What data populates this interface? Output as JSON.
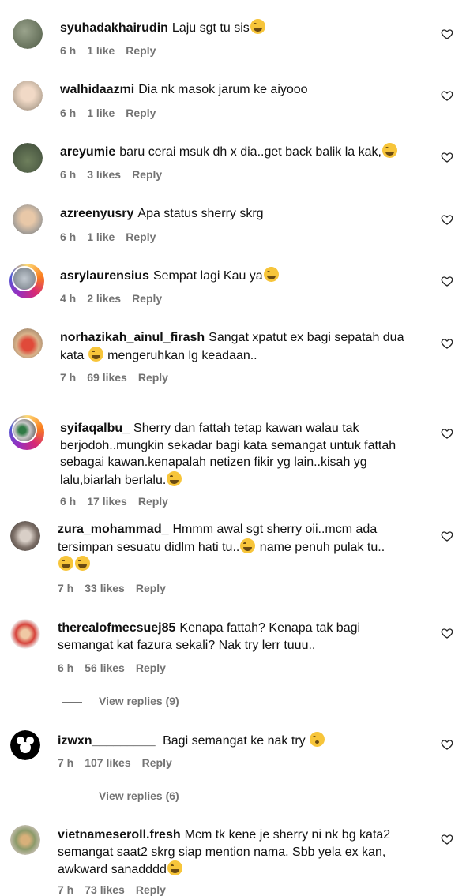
{
  "comments": [
    {
      "username": "syuhadakhairudin",
      "text": "Laju sgt tu sis",
      "emoji": "😂",
      "time": "6 h",
      "likes": "1 like",
      "reply": "Reply"
    },
    {
      "username": "walhidaazmi",
      "text": "Dia nk masok jarum ke aiyooo",
      "emoji": "",
      "time": "6 h",
      "likes": "1 like",
      "reply": "Reply"
    },
    {
      "username": "areyumie",
      "text": "baru cerai msuk dh x dia..get back balik la kak,",
      "emoji": "😂",
      "time": "6 h",
      "likes": "3 likes",
      "reply": "Reply"
    },
    {
      "username": "azreenyusry",
      "text": "Apa status sherry skrg",
      "emoji": "",
      "time": "6 h",
      "likes": "1 like",
      "reply": "Reply"
    },
    {
      "username": "asrylaurensius",
      "text": "Sempat lagi Kau ya",
      "emoji": "😂",
      "time": "4 h",
      "likes": "2 likes",
      "reply": "Reply"
    },
    {
      "username": "norhazikah_ainul_firash",
      "text_a": "Sangat xpatut ex bagi sepatah dua kata",
      "text_b": "mengeruhkan lg keadaan..",
      "time": "7 h",
      "likes": "69 likes",
      "reply": "Reply"
    },
    {
      "username": "syifaqalbu_",
      "text": "Sherry dan fattah tetap kawan walau tak berjodoh..mungkin sekadar bagi kata semangat untuk fattah sebagai kawan.kenapalah netizen fikir yg lain..kisah yg lalu,biarlah berlalu.",
      "emoji": "😂",
      "time": "6 h",
      "likes": "17 likes",
      "reply": "Reply"
    },
    {
      "username": "zura_mohammad_",
      "text_a": "Hmmm awal sgt sherry oii..mcm ada tersimpan sesuatu didlm hati tu..",
      "text_b": "name penuh pulak tu..",
      "time": "7 h",
      "likes": "33 likes",
      "reply": "Reply"
    },
    {
      "username": "therealofmecsuej85",
      "text": "Kenapa fattah? Kenapa tak bagi semangat kat fazura sekali? Nak try lerr tuuu..",
      "emoji": "",
      "time": "6 h",
      "likes": "56 likes",
      "reply": "Reply",
      "view_replies": "View replies (9)"
    },
    {
      "username": "izwxn_________",
      "text": "Bagi semangat ke nak try",
      "emoji": "😚",
      "time": "7 h",
      "likes": "107 likes",
      "reply": "Reply",
      "view_replies": "View replies (6)"
    },
    {
      "username": "vietnameseroll.fresh",
      "text": "Mcm tk kene je sherry ni nk bg kata2 semangat saat2 skrg siap mention nama. Sbb yela ex kan, awkward sanadddd",
      "emoji": "😂",
      "time": "7 h",
      "likes": "73 likes",
      "reply": "Reply"
    }
  ],
  "colors": {
    "meta": "#737373",
    "text": "#111111",
    "heart": "#262626"
  },
  "icons": {
    "like": "heart-outline-icon",
    "reaction": "tears-of-joy-emoji"
  }
}
